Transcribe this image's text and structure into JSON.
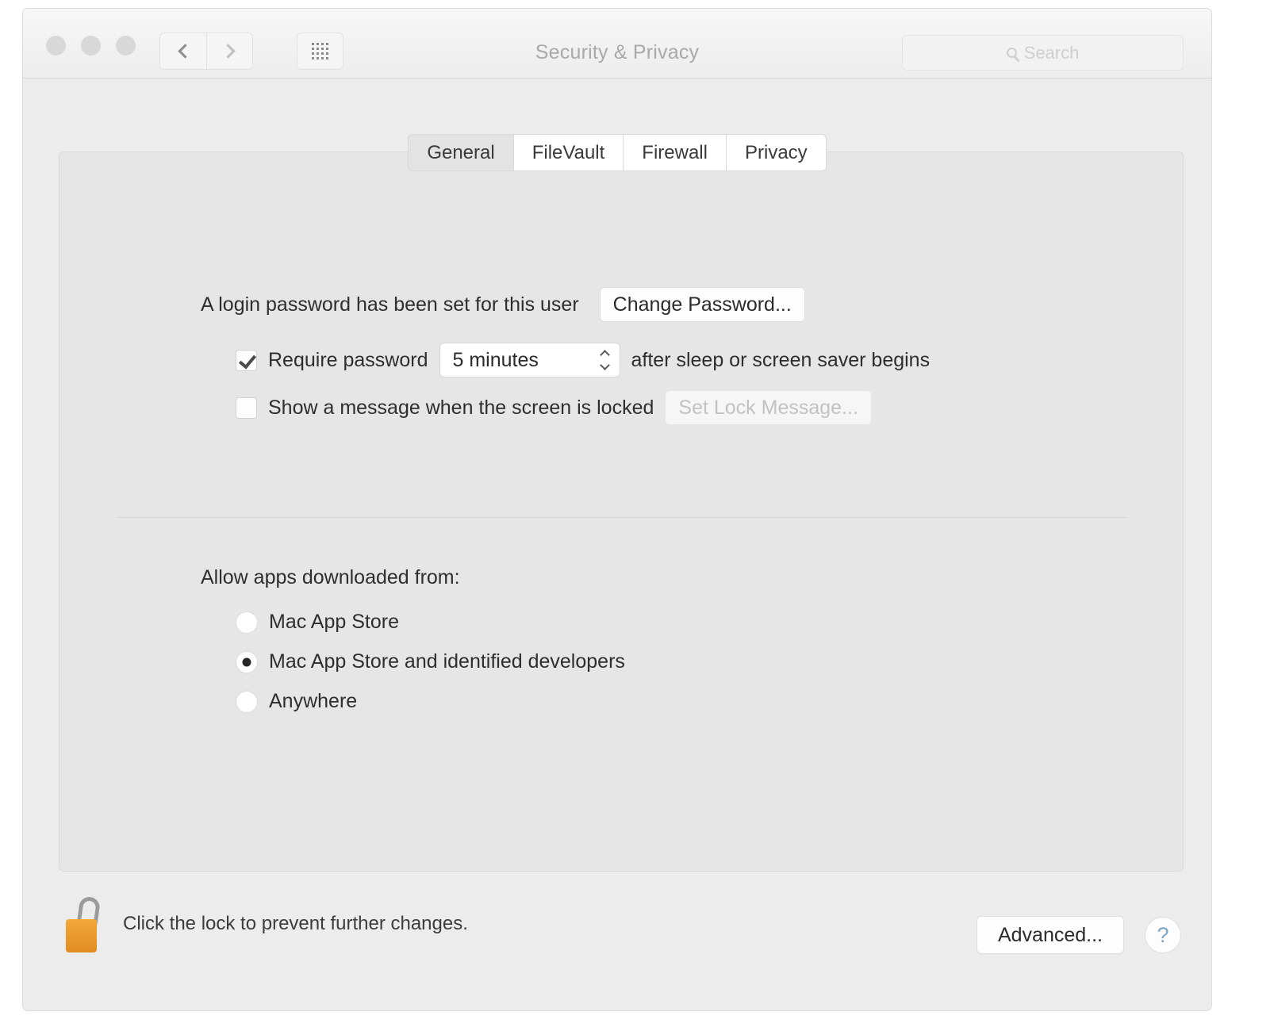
{
  "window": {
    "title": "Security & Privacy",
    "traffic_lights": [
      "close",
      "minimize",
      "zoom"
    ],
    "nav": {
      "back": "back-chevron",
      "forward": "forward-chevron",
      "grid": "show-all-grid"
    },
    "search": {
      "placeholder": "Search",
      "icon": "search-icon"
    }
  },
  "tabs": [
    {
      "label": "General",
      "selected": true
    },
    {
      "label": "FileVault",
      "selected": false
    },
    {
      "label": "Firewall",
      "selected": false
    },
    {
      "label": "Privacy",
      "selected": false
    }
  ],
  "general": {
    "login_password_text": "A login password has been set for this user",
    "change_password_label": "Change Password...",
    "require_password": {
      "checked": true,
      "label": "Require password",
      "interval_value": "5 minutes",
      "suffix": "after sleep or screen saver begins"
    },
    "show_message": {
      "checked": false,
      "label": "Show a message when the screen is locked",
      "button_label": "Set Lock Message...",
      "button_disabled": true
    },
    "allow_apps": {
      "heading": "Allow apps downloaded from:",
      "options": [
        {
          "label": "Mac App Store",
          "selected": false
        },
        {
          "label": "Mac App Store and identified developers",
          "selected": true
        },
        {
          "label": "Anywhere",
          "selected": false
        }
      ]
    }
  },
  "footer": {
    "lock_icon": "unlocked-padlock-icon",
    "lock_caption": "Click the lock to prevent further changes.",
    "advanced_label": "Advanced...",
    "help_label": "?"
  },
  "colors": {
    "window_bg": "#ececec",
    "panel_bg": "#e6e6e6",
    "titlebar_bg": "#f2f2f2",
    "lock_gold": "#e8951f",
    "help_blue": "#7fa6c4",
    "text": "#2e2e2e",
    "muted_text": "#a9a9a9"
  }
}
